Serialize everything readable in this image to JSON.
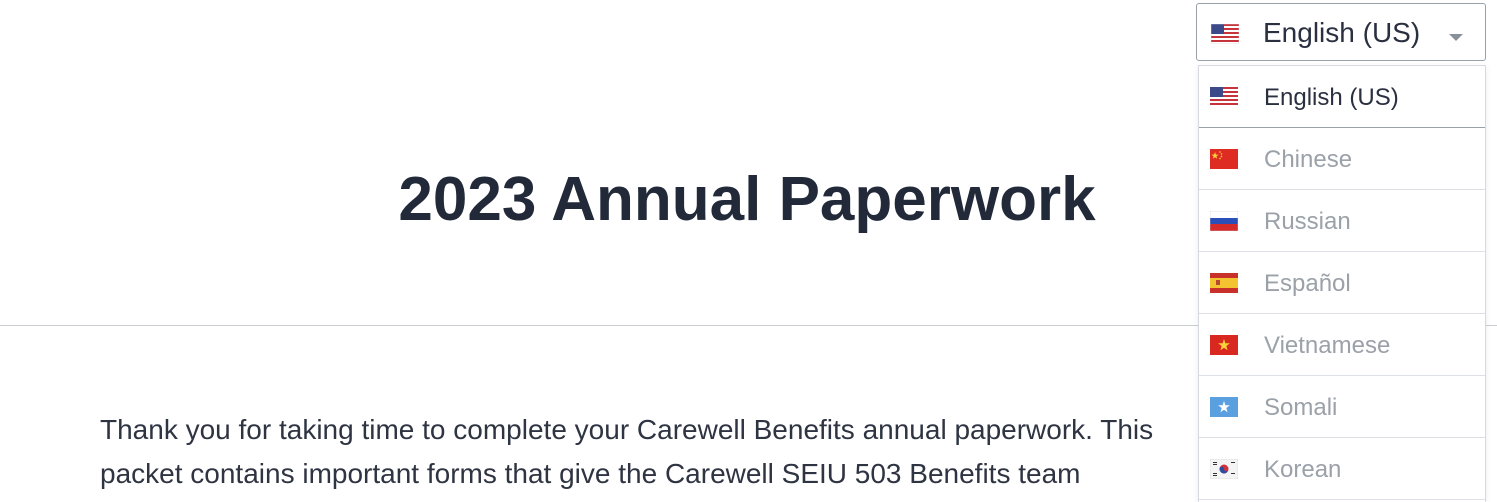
{
  "language_selector": {
    "selected_label": "English (US)",
    "selected_flag": "us-flag-icon",
    "options": [
      {
        "label": "English (US)",
        "flag": "us-flag-icon",
        "selected": true
      },
      {
        "label": "Chinese",
        "flag": "china-flag-icon",
        "selected": false
      },
      {
        "label": "Russian",
        "flag": "russia-flag-icon",
        "selected": false
      },
      {
        "label": "Español",
        "flag": "spain-flag-icon",
        "selected": false
      },
      {
        "label": "Vietnamese",
        "flag": "vietnam-flag-icon",
        "selected": false
      },
      {
        "label": "Somali",
        "flag": "somalia-flag-icon",
        "selected": false
      },
      {
        "label": "Korean",
        "flag": "korea-flag-icon",
        "selected": false
      }
    ]
  },
  "main": {
    "title": "2023 Annual Paperwork",
    "intro_line1": "Thank you for taking time to complete your Carewell Benefits annual paperwork. This",
    "intro_line2": "packet contains important forms that give the Carewell SEIU 503 Benefits team"
  },
  "colors": {
    "text_dark": "#222a3a",
    "text_muted": "#9ba1a9",
    "border": "#9aa0a8",
    "divider": "#c9ccd1"
  }
}
